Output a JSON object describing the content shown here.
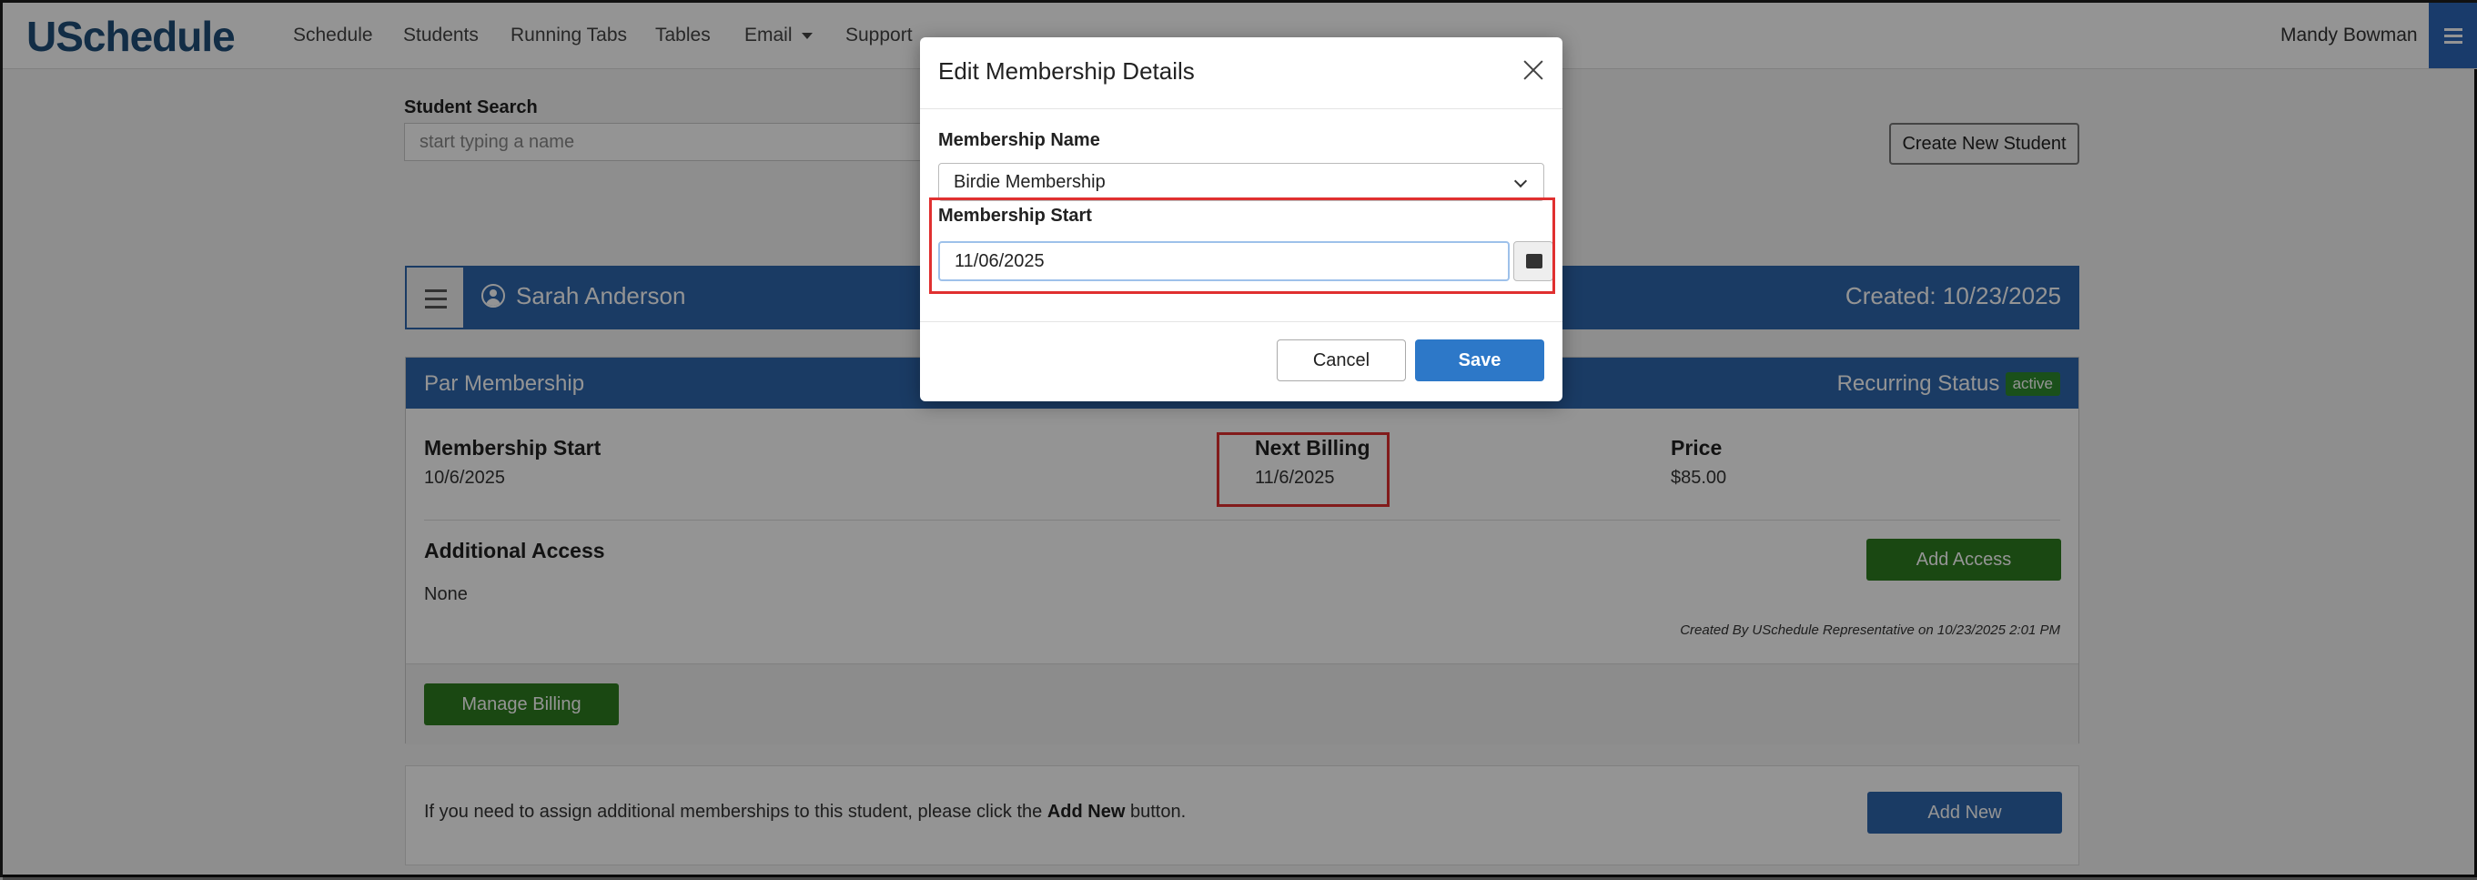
{
  "app": {
    "logo": "USchedule",
    "nav": [
      "Schedule",
      "Students",
      "Running Tabs",
      "Tables",
      "Email",
      "Support"
    ],
    "user": "Mandy Bowman"
  },
  "search": {
    "label": "Student Search",
    "placeholder": "start typing a name",
    "create_button": "Create New Student"
  },
  "student": {
    "name": "Sarah Anderson",
    "created": "Created: 10/23/2025"
  },
  "membership_card": {
    "title": "Par Membership",
    "recurring_label": "Recurring Status -",
    "status_badge": "active",
    "start_label": "Membership Start",
    "start_value": "10/6/2025",
    "next_billing_label": "Next Billing",
    "next_billing_value": "11/6/2025",
    "price_label": "Price",
    "price_value": "$85.00",
    "additional_access_label": "Additional Access",
    "additional_access_value": "None",
    "add_access_button": "Add Access",
    "created_by": "Created By USchedule Representative on 10/23/2025 2:01 PM",
    "manage_billing_button": "Manage Billing"
  },
  "add_new": {
    "text_before": "If you need to assign additional memberships to this student, please click the ",
    "text_bold": "Add New",
    "text_after": " button.",
    "button": "Add New"
  },
  "modal": {
    "title": "Edit Membership Details",
    "membership_name_label": "Membership Name",
    "membership_name_value": "Birdie Membership",
    "membership_start_label": "Membership Start",
    "membership_start_value": "11/06/2025",
    "cancel_button": "Cancel",
    "save_button": "Save"
  },
  "colors": {
    "brand_blue": "#2d66ad",
    "success_green": "#2e7d1f",
    "highlight_red": "#e03030",
    "logo_blue": "#1f4e79"
  }
}
